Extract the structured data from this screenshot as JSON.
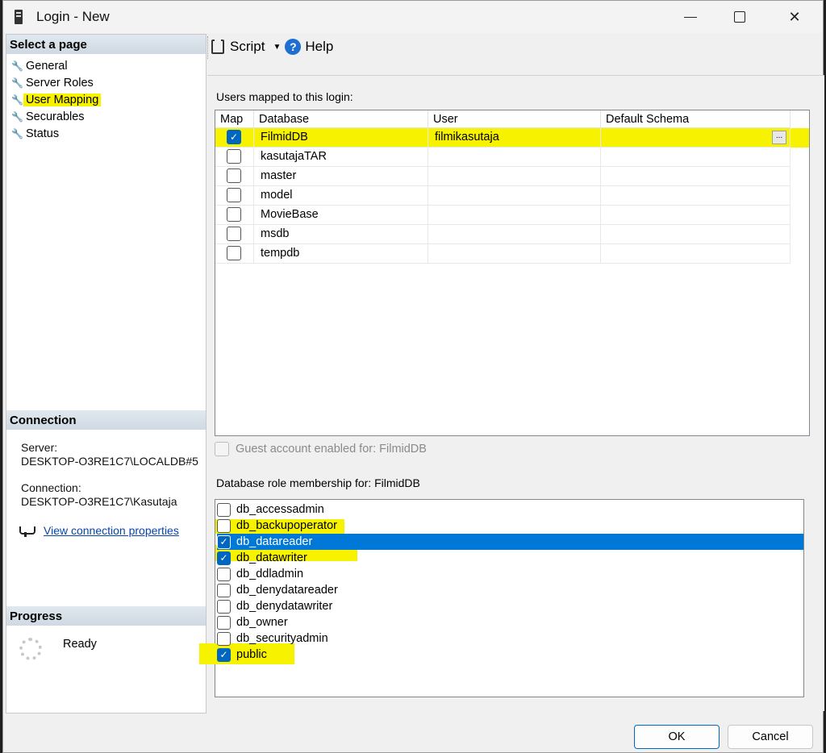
{
  "window": {
    "title": "Login - New"
  },
  "left_pane": {
    "select_page_header": "Select a page",
    "pages": [
      {
        "label": "General",
        "active": false
      },
      {
        "label": "Server Roles",
        "active": false
      },
      {
        "label": "User Mapping",
        "active": true
      },
      {
        "label": "Securables",
        "active": false
      },
      {
        "label": "Status",
        "active": false
      }
    ],
    "connection_header": "Connection",
    "server_label": "Server:",
    "server_value": "DESKTOP-O3RE1C7\\LOCALDB#5",
    "connection_label": "Connection:",
    "connection_value": "DESKTOP-O3RE1C7\\Kasutaja",
    "view_connection_link": "View connection properties",
    "progress_header": "Progress",
    "progress_status": "Ready"
  },
  "toolbar": {
    "script_label": "Script",
    "help_label": "Help"
  },
  "users_mapped": {
    "label": "Users mapped to this login:",
    "columns": [
      "Map",
      "Database",
      "User",
      "Default Schema"
    ],
    "rows": [
      {
        "map": true,
        "database": "FilmidDB",
        "user": "filmikasutaja",
        "schema": ""
      },
      {
        "map": false,
        "database": "kasutajaTAR",
        "user": "",
        "schema": ""
      },
      {
        "map": false,
        "database": "master",
        "user": "",
        "schema": ""
      },
      {
        "map": false,
        "database": "model",
        "user": "",
        "schema": ""
      },
      {
        "map": false,
        "database": "MovieBase",
        "user": "",
        "schema": ""
      },
      {
        "map": false,
        "database": "msdb",
        "user": "",
        "schema": ""
      },
      {
        "map": false,
        "database": "tempdb",
        "user": "",
        "schema": ""
      }
    ],
    "ellipsis": "..."
  },
  "guest_account": {
    "label": "Guest account enabled for: FilmidDB",
    "checked": false
  },
  "role_membership": {
    "label": "Database role membership for: FilmidDB",
    "roles": [
      {
        "name": "db_accessadmin",
        "checked": false
      },
      {
        "name": "db_backupoperator",
        "checked": false
      },
      {
        "name": "db_datareader",
        "checked": true
      },
      {
        "name": "db_datawriter",
        "checked": true
      },
      {
        "name": "db_ddladmin",
        "checked": false
      },
      {
        "name": "db_denydatareader",
        "checked": false
      },
      {
        "name": "db_denydatawriter",
        "checked": false
      },
      {
        "name": "db_owner",
        "checked": false
      },
      {
        "name": "db_securityadmin",
        "checked": false
      },
      {
        "name": "public",
        "checked": true
      }
    ],
    "selected": "db_datareader"
  },
  "buttons": {
    "ok": "OK",
    "cancel": "Cancel"
  },
  "colors": {
    "highlight": "#f7f200",
    "selection": "#0078d7",
    "link": "#0645ad",
    "checkbox_on": "#0067c0"
  }
}
